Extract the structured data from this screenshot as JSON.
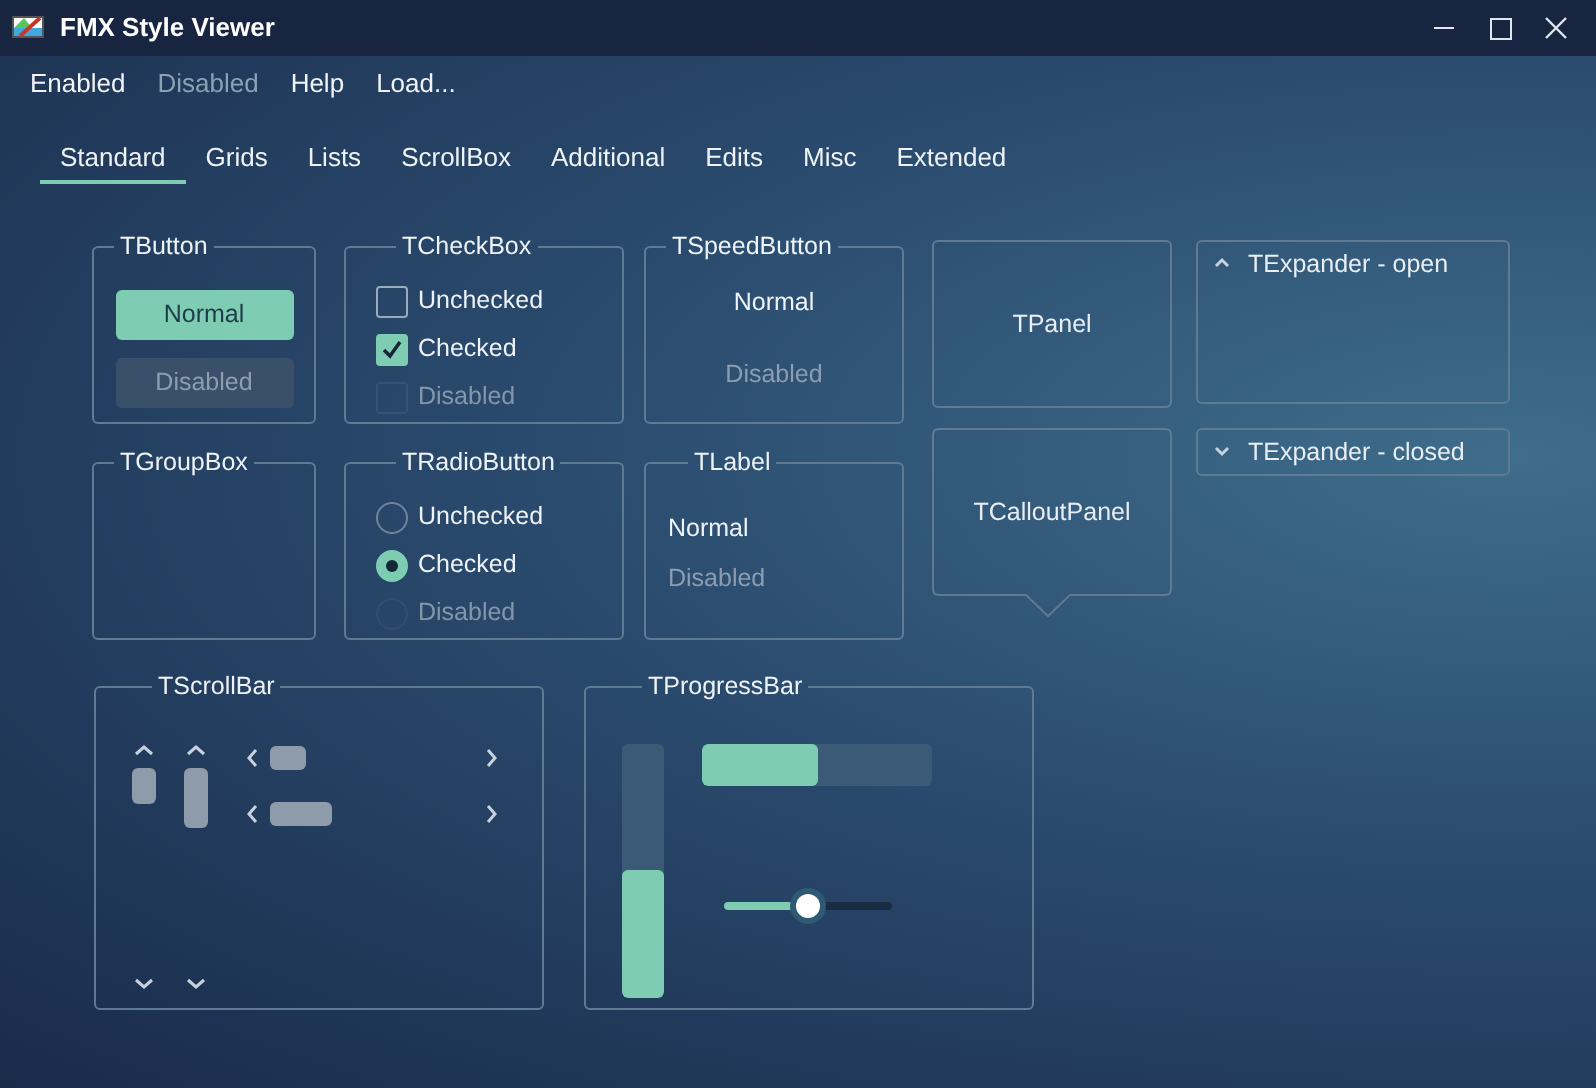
{
  "window": {
    "title": "FMX Style Viewer"
  },
  "menu": [
    {
      "label": "Enabled",
      "disabled": false
    },
    {
      "label": "Disabled",
      "disabled": true
    },
    {
      "label": "Help",
      "disabled": false
    },
    {
      "label": "Load...",
      "disabled": false
    }
  ],
  "tabs": [
    {
      "label": "Standard",
      "selected": true
    },
    {
      "label": "Grids",
      "selected": false
    },
    {
      "label": "Lists",
      "selected": false
    },
    {
      "label": "ScrollBox",
      "selected": false
    },
    {
      "label": "Additional",
      "selected": false
    },
    {
      "label": "Edits",
      "selected": false
    },
    {
      "label": "Misc",
      "selected": false
    },
    {
      "label": "Extended",
      "selected": false
    }
  ],
  "tbutton": {
    "title": "TButton",
    "buttons": [
      {
        "label": "Normal",
        "disabled": false
      },
      {
        "label": "Disabled",
        "disabled": true
      }
    ]
  },
  "tcheckbox": {
    "title": "TCheckBox",
    "items": [
      {
        "label": "Unchecked",
        "checked": false,
        "disabled": false
      },
      {
        "label": "Checked",
        "checked": true,
        "disabled": false
      },
      {
        "label": "Disabled",
        "checked": false,
        "disabled": true
      }
    ]
  },
  "tspeedbutton": {
    "title": "TSpeedButton",
    "buttons": [
      {
        "label": "Normal",
        "disabled": false
      },
      {
        "label": "Disabled",
        "disabled": true
      }
    ]
  },
  "tpanel": {
    "label": "TPanel"
  },
  "expanders": [
    {
      "title": "TExpander - open",
      "expanded": true
    },
    {
      "title": "TExpander - closed",
      "expanded": false
    }
  ],
  "tgroupbox": {
    "title": "TGroupBox"
  },
  "tradiobutton": {
    "title": "TRadioButton",
    "items": [
      {
        "label": "Unchecked",
        "selected": false,
        "disabled": false
      },
      {
        "label": "Checked",
        "selected": true,
        "disabled": false
      },
      {
        "label": "Disabled",
        "selected": false,
        "disabled": true
      }
    ]
  },
  "tlabel": {
    "title": "TLabel",
    "labels": [
      {
        "text": "Normal",
        "disabled": false
      },
      {
        "text": "Disabled",
        "disabled": true
      }
    ]
  },
  "tcalloutpanel": {
    "label": "TCalloutPanel"
  },
  "tscrollbar": {
    "title": "TScrollBar"
  },
  "tprogressbar": {
    "title": "TProgressBar",
    "bars": [
      {
        "kind": "vertical",
        "level": 0.5
      },
      {
        "kind": "horizontal",
        "level": 0.5
      }
    ],
    "slider": {
      "level": 0.5
    }
  }
}
